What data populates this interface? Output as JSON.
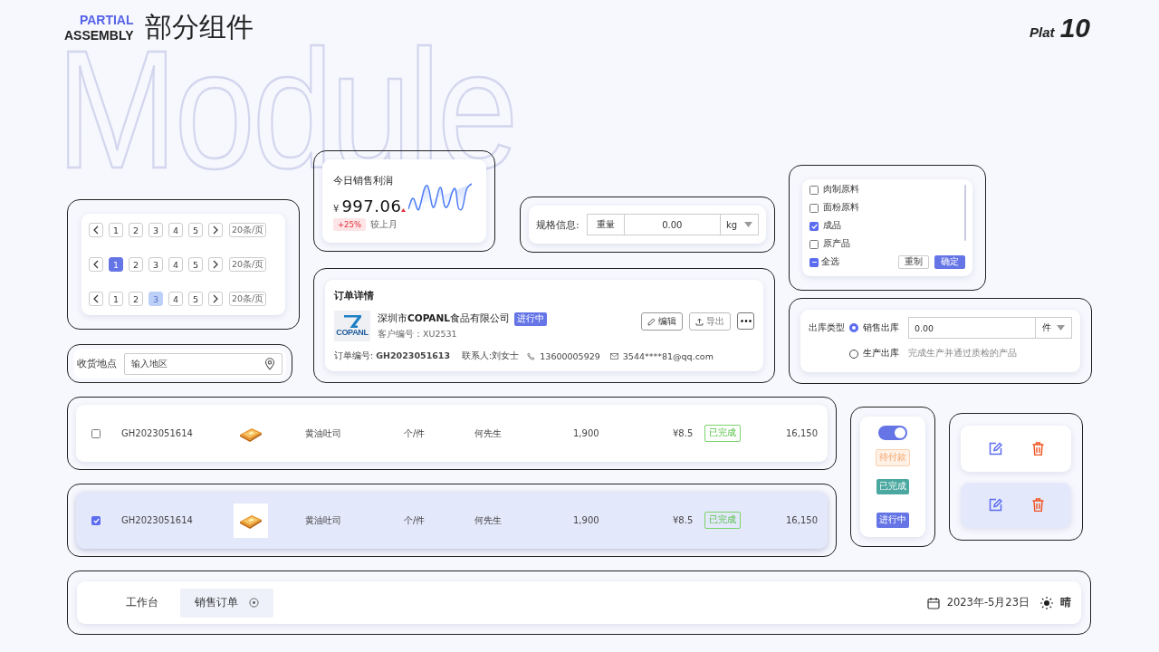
{
  "header": {
    "tag_top": "PARTIAL",
    "tag_bottom": "ASSEMBLY",
    "title": "部分组件",
    "backdrop": "Module",
    "plat_label": "Plat",
    "plat_number": "10"
  },
  "pagination": [
    {
      "pages": [
        {
          "label": "1",
          "selected": false,
          "hovered": false
        },
        {
          "label": "2",
          "selected": false,
          "hovered": false
        },
        {
          "label": "3",
          "selected": false,
          "hovered": false
        },
        {
          "label": "4",
          "selected": false,
          "hovered": false
        },
        {
          "label": "5",
          "selected": false,
          "hovered": false
        }
      ],
      "size": "20条/页"
    },
    {
      "pages": [
        {
          "label": "1",
          "selected": true,
          "hovered": false
        },
        {
          "label": "2",
          "selected": false,
          "hovered": false
        },
        {
          "label": "3",
          "selected": false,
          "hovered": false
        },
        {
          "label": "4",
          "selected": false,
          "hovered": false
        },
        {
          "label": "5",
          "selected": false,
          "hovered": false
        }
      ],
      "size": "20条/页"
    },
    {
      "pages": [
        {
          "label": "1",
          "selected": false,
          "hovered": false
        },
        {
          "label": "2",
          "selected": false,
          "hovered": false
        },
        {
          "label": "3",
          "selected": false,
          "hovered": true
        },
        {
          "label": "4",
          "selected": false,
          "hovered": false
        },
        {
          "label": "5",
          "selected": false,
          "hovered": false
        }
      ],
      "size": "20条/页"
    }
  ],
  "address": {
    "label": "收货地点",
    "placeholder": "输入地区"
  },
  "profit": {
    "title": "今日销售利润",
    "currency": "¥",
    "value": "997.06",
    "change": "+25%",
    "compare": "较上月"
  },
  "spec": {
    "label": "规格信息:",
    "field": "重量",
    "value": "0.00",
    "unit": "kg"
  },
  "order": {
    "title": "订单详情",
    "logo_text": "COPANL",
    "company": "深圳市**COPANL**食品有限公司",
    "status": "进行中",
    "customer": "客户编号：XU2531",
    "buttons": [
      "编辑",
      "导出"
    ],
    "order_no": "订单编号: **GH2023051613**",
    "contact": "联系人:刘女士",
    "phone": "13600005929",
    "email": "3544****81@qq.com"
  },
  "filter": {
    "options": [
      {
        "label": "肉制原料",
        "checked": false
      },
      {
        "label": "面粉原料",
        "checked": false
      },
      {
        "label": "成品",
        "checked": true
      },
      {
        "label": "原产品",
        "checked": false
      }
    ],
    "select_all": {
      "label": "全选",
      "partial": true
    },
    "reset": "重制",
    "confirm": "确定"
  },
  "outbound": {
    "label": "出库类型",
    "options": [
      {
        "label": "销售出库",
        "selected": true
      },
      {
        "label": "生产出库",
        "selected": false,
        "note": "完成生产并通过质检的产品"
      }
    ],
    "value": "0.00",
    "unit": "件"
  },
  "rows": [
    {
      "selected": false,
      "order_no": "GH2023051614",
      "product": "黄油吐司",
      "unit": "个/件",
      "customer": "何先生",
      "quantity": "1,900",
      "price": "¥8.5",
      "status": "已完成",
      "total": "16,150"
    },
    {
      "selected": true,
      "order_no": "GH2023051614",
      "product": "黄油吐司",
      "unit": "个/件",
      "customer": "何先生",
      "quantity": "1,900",
      "price": "¥8.5",
      "status": "已完成",
      "total": "16,150"
    }
  ],
  "status_panel": {
    "switch_on": true,
    "tags": [
      {
        "label": "待付款",
        "kind": "pending"
      },
      {
        "label": "已完成",
        "kind": "done"
      },
      {
        "label": "进行中",
        "kind": "progress"
      }
    ]
  },
  "action_rows": [
    {
      "highlighted": false
    },
    {
      "highlighted": true
    }
  ],
  "footer": {
    "tabs": [
      {
        "label": "工作台",
        "selected": false
      },
      {
        "label": "销售订单",
        "selected": true
      }
    ],
    "date": "2023年-5月23日",
    "weather": "晴"
  }
}
